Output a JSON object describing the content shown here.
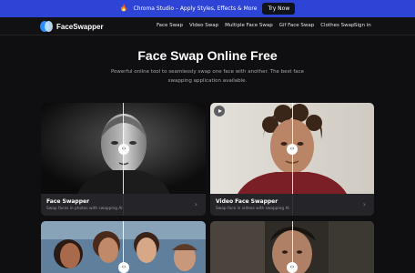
{
  "promo": {
    "icon": "fire-icon",
    "text": "Chroma Studio – Apply Styles, Effects & More",
    "button": "Try Now"
  },
  "nav": {
    "logo_text": "FaceSwapper",
    "links": [
      "Face Swap",
      "Video Swap",
      "Multiple Face Swap",
      "Gif Face Swap",
      "Clothes Swap"
    ],
    "sign_in": "Sign in"
  },
  "hero": {
    "title": "Face Swap Online Free",
    "subtitle": "Powerful online tool to seamlessly swap one face with another. The best face swapping application available."
  },
  "cards": [
    {
      "title": "Face Swapper",
      "desc": "Swap faces in photos with swapping AI"
    },
    {
      "title": "Video Face Swapper",
      "desc": "Swap face in videos with swapping AI"
    }
  ],
  "icons": {
    "compare_handle": "compare-arrows-icon",
    "chevron": "chevron-right-icon",
    "play": "play-icon"
  },
  "colors": {
    "promo_bg": "#2d44d6",
    "page_bg": "#0f0f11",
    "card_bg": "#1b1b1f",
    "logo_blue": "#2b8cff"
  }
}
